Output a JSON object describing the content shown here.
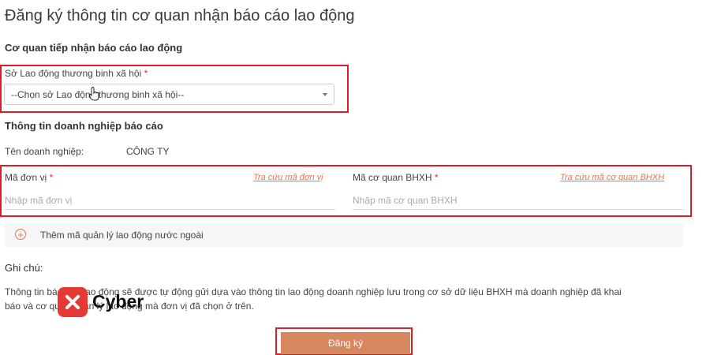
{
  "page": {
    "title": "Đăng ký thông tin cơ quan nhận báo cáo lao động"
  },
  "agency": {
    "heading": "Cơ quan tiếp nhận báo cáo lao động",
    "field_label": "Sở Lao động thương binh xã hội",
    "required_mark": "*",
    "select_value": "--Chọn sở Lao động thương binh xã hội--"
  },
  "company": {
    "heading": "Thông tin doanh nghiệp báo cáo",
    "name_label": "Tên doanh nghiệp:",
    "name_value": "CÔNG TY"
  },
  "unit_code": {
    "label": "Mã đơn vị",
    "required_mark": "*",
    "lookup_link": "Tra cứu mã đơn vị",
    "placeholder": "Nhập mã đơn vị"
  },
  "bhxh_code": {
    "label": "Mã cơ quan BHXH",
    "required_mark": "*",
    "lookup_link": "Tra cứu mã cơ quan BHXH",
    "placeholder": "Nhập mã cơ quan BHXH"
  },
  "add_foreign": {
    "label": "Thêm mã quản lý lao động nước ngoài"
  },
  "notes": {
    "heading": "Ghi chú:",
    "line1": "Thông tin báo cáo lao động sẽ được tự động gửi dựa vào thông tin lao động doanh nghiệp lưu trong cơ sở dữ liệu BHXH mà doanh nghiệp đã khai",
    "line2": "báo và cơ quan quản lý lao động mà đơn vị đã chọn ở trên."
  },
  "actions": {
    "submit_label": "Đăng ký"
  },
  "watermark": {
    "brand": "Cyber"
  },
  "colors": {
    "highlight": "#d9202a",
    "accent": "#e0794f",
    "button": "#d6875e"
  }
}
